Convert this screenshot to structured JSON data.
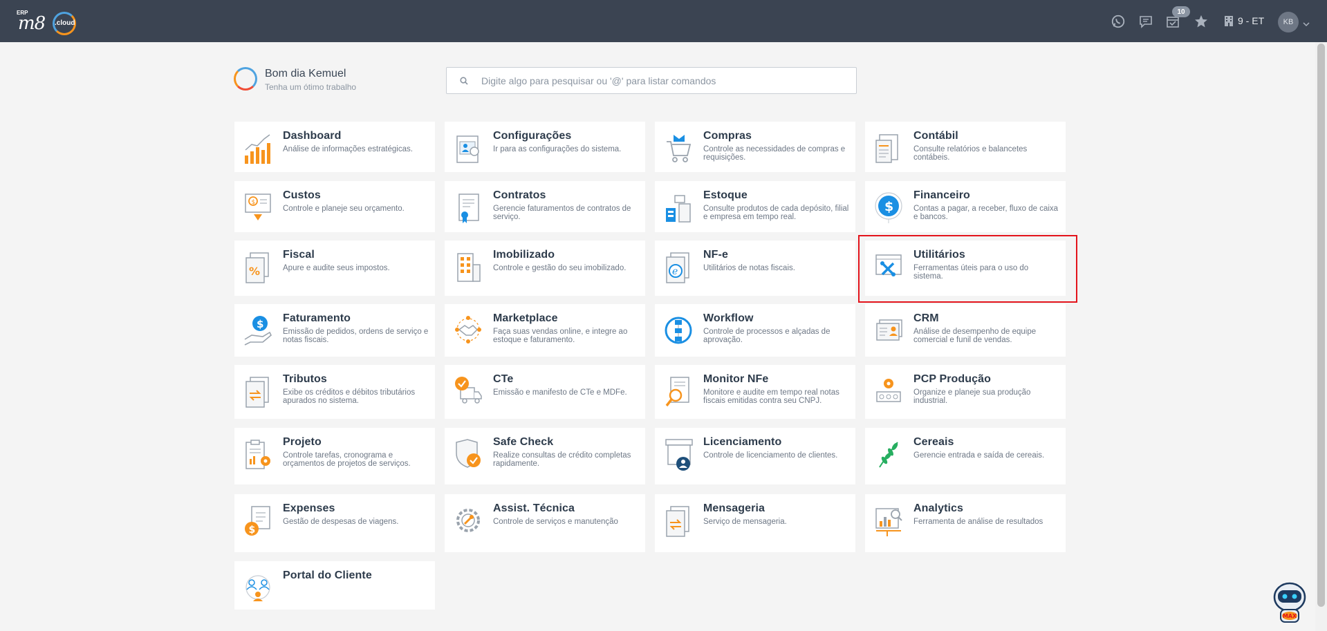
{
  "topbar": {
    "logo_erp": "ERP",
    "logo_m8": "m8",
    "logo_cloud": ".cloud",
    "notification_count": "10",
    "company": "9 - ET",
    "user_initials": "KB"
  },
  "greeting": {
    "title": "Bom dia Kemuel",
    "subtitle": "Tenha um ótimo trabalho"
  },
  "search": {
    "placeholder": "Digite algo para pesquisar ou '@' para listar comandos"
  },
  "modules": [
    {
      "title": "Dashboard",
      "desc": "Análise de informações estratégicas."
    },
    {
      "title": "Configurações",
      "desc": "Ir para as configurações do sistema."
    },
    {
      "title": "Compras",
      "desc": "Controle as necessidades de compras e requisições."
    },
    {
      "title": "Contábil",
      "desc": "Consulte relatórios e balancetes contábeis."
    },
    {
      "title": "Custos",
      "desc": "Controle e planeje seu orçamento."
    },
    {
      "title": "Contratos",
      "desc": "Gerencie faturamentos de contratos de serviço."
    },
    {
      "title": "Estoque",
      "desc": "Consulte produtos de cada depósito, filial e empresa em tempo real."
    },
    {
      "title": "Financeiro",
      "desc": "Contas a pagar, a receber, fluxo de caixa e bancos."
    },
    {
      "title": "Fiscal",
      "desc": "Apure e audite seus impostos."
    },
    {
      "title": "Imobilizado",
      "desc": "Controle e gestão do seu imobilizado."
    },
    {
      "title": "NF-e",
      "desc": "Utilitários de notas fiscais."
    },
    {
      "title": "Utilitários",
      "desc": "Ferramentas úteis para o uso do sistema."
    },
    {
      "title": "Faturamento",
      "desc": "Emissão de pedidos, ordens de serviço e notas fiscais."
    },
    {
      "title": "Marketplace",
      "desc": "Faça suas vendas online, e integre ao estoque e faturamento."
    },
    {
      "title": "Workflow",
      "desc": "Controle de processos e alçadas de aprovação."
    },
    {
      "title": "CRM",
      "desc": "Análise de desempenho de equipe comercial e funil de vendas."
    },
    {
      "title": "Tributos",
      "desc": "Exibe os créditos e débitos tributários apurados no sistema."
    },
    {
      "title": "CTe",
      "desc": "Emissão e manifesto de CTe e MDFe."
    },
    {
      "title": "Monitor NFe",
      "desc": "Monitore e audite em tempo real notas fiscais emitidas contra seu CNPJ."
    },
    {
      "title": "PCP Produção",
      "desc": "Organize e planeje sua produção industrial."
    },
    {
      "title": "Projeto",
      "desc": "Controle tarefas, cronograma e orçamentos de projetos de serviços."
    },
    {
      "title": "Safe Check",
      "desc": "Realize consultas de crédito completas rapidamente."
    },
    {
      "title": "Licenciamento",
      "desc": "Controle de licenciamento de clientes."
    },
    {
      "title": "Cereais",
      "desc": "Gerencie entrada e saída de cereais."
    },
    {
      "title": "Expenses",
      "desc": "Gestão de despesas de viagens."
    },
    {
      "title": "Assist. Técnica",
      "desc": "Controle de serviços e manutenção"
    },
    {
      "title": "Mensageria",
      "desc": "Serviço de mensageria."
    },
    {
      "title": "Analytics",
      "desc": "Ferramenta de análise de resultados"
    },
    {
      "title": "Portal do Cliente",
      "desc": ""
    }
  ],
  "assistant": {
    "label": "MAX"
  },
  "colors": {
    "topbar": "#3b4452",
    "accent_orange": "#f7941d",
    "accent_blue": "#1a8fe3",
    "highlight": "#e3131b"
  }
}
